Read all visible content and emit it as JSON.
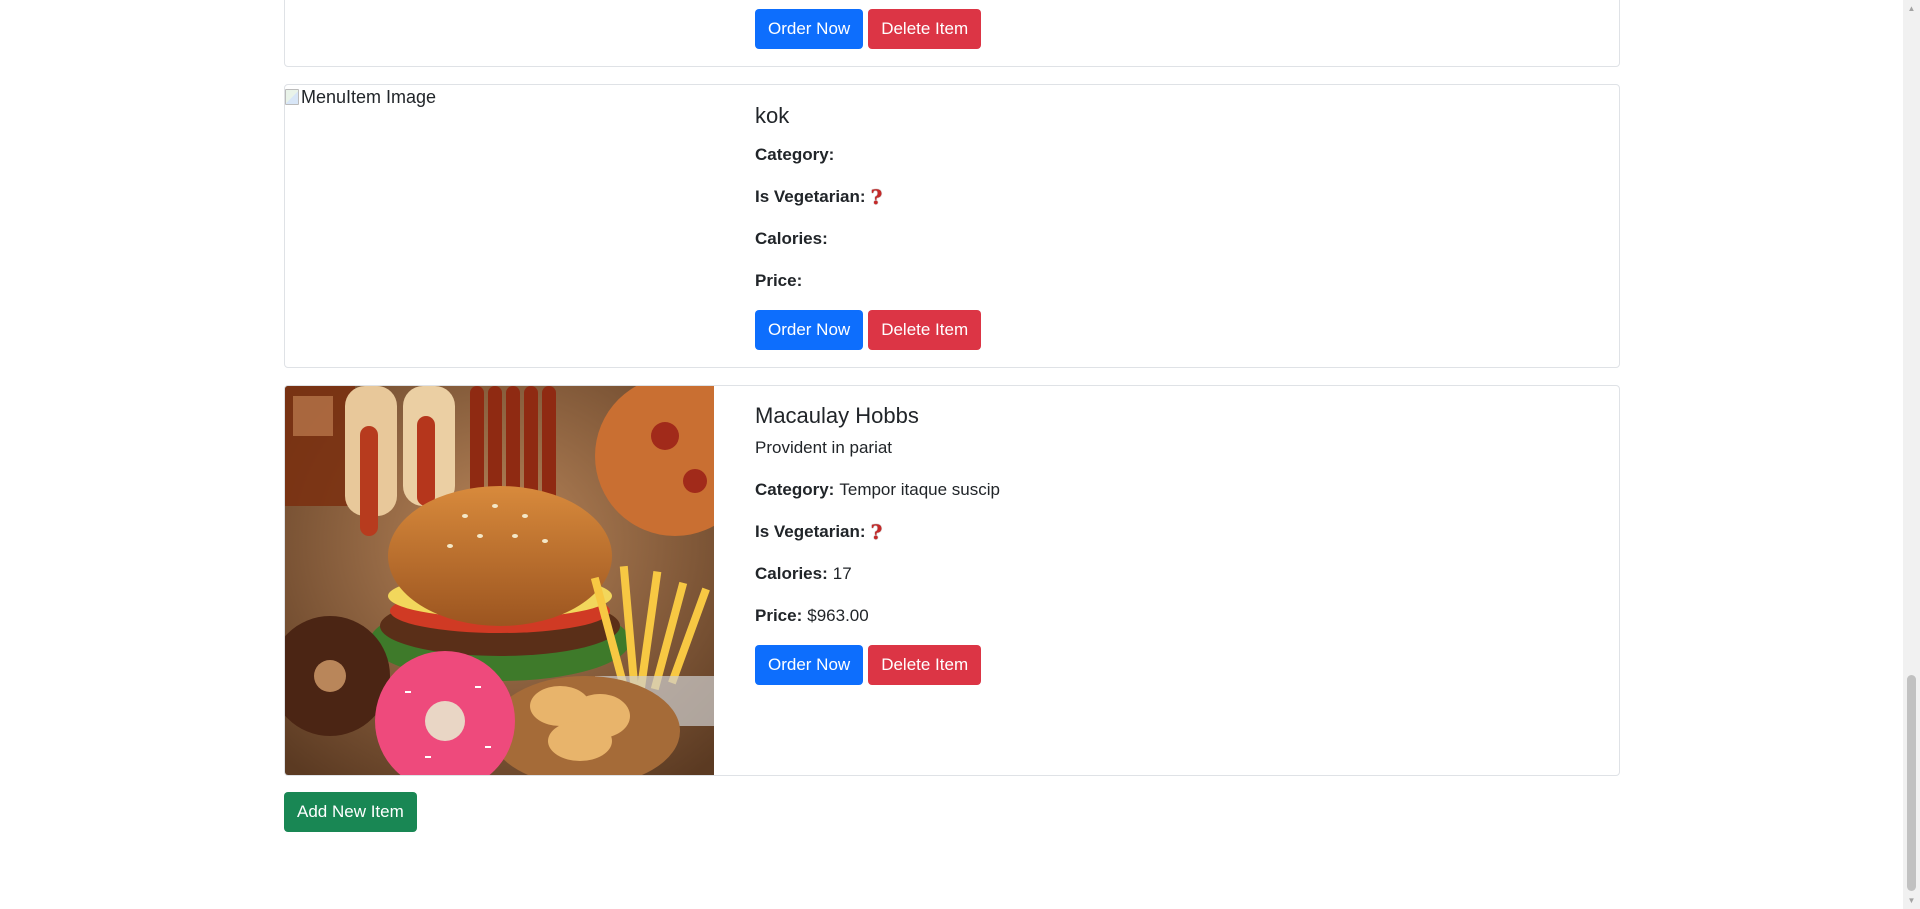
{
  "items": [
    {
      "order_label": "Order Now",
      "delete_label": "Delete Item"
    },
    {
      "image_alt": "MenuItem Image",
      "name": "kok",
      "category_label": "Category:",
      "category": "",
      "vegetarian_label": "Is Vegetarian:",
      "vegetarian_icon": "red-question-mark-icon",
      "calories_label": "Calories:",
      "calories": "",
      "price_label": "Price:",
      "price": "",
      "order_label": "Order Now",
      "delete_label": "Delete Item"
    },
    {
      "image_icon": "fast-food-photo",
      "name": "Macaulay Hobbs",
      "description": "Provident in pariat",
      "category_label": "Category:",
      "category": "Tempor itaque suscip",
      "vegetarian_label": "Is Vegetarian:",
      "vegetarian_icon": "red-question-mark-icon",
      "calories_label": "Calories:",
      "calories": "17",
      "price_label": "Price:",
      "price": "$963.00",
      "order_label": "Order Now",
      "delete_label": "Delete Item"
    }
  ],
  "add_new_label": "Add New Item",
  "colors": {
    "primary": "#0d6efd",
    "danger": "#dc3545",
    "success": "#198754"
  }
}
